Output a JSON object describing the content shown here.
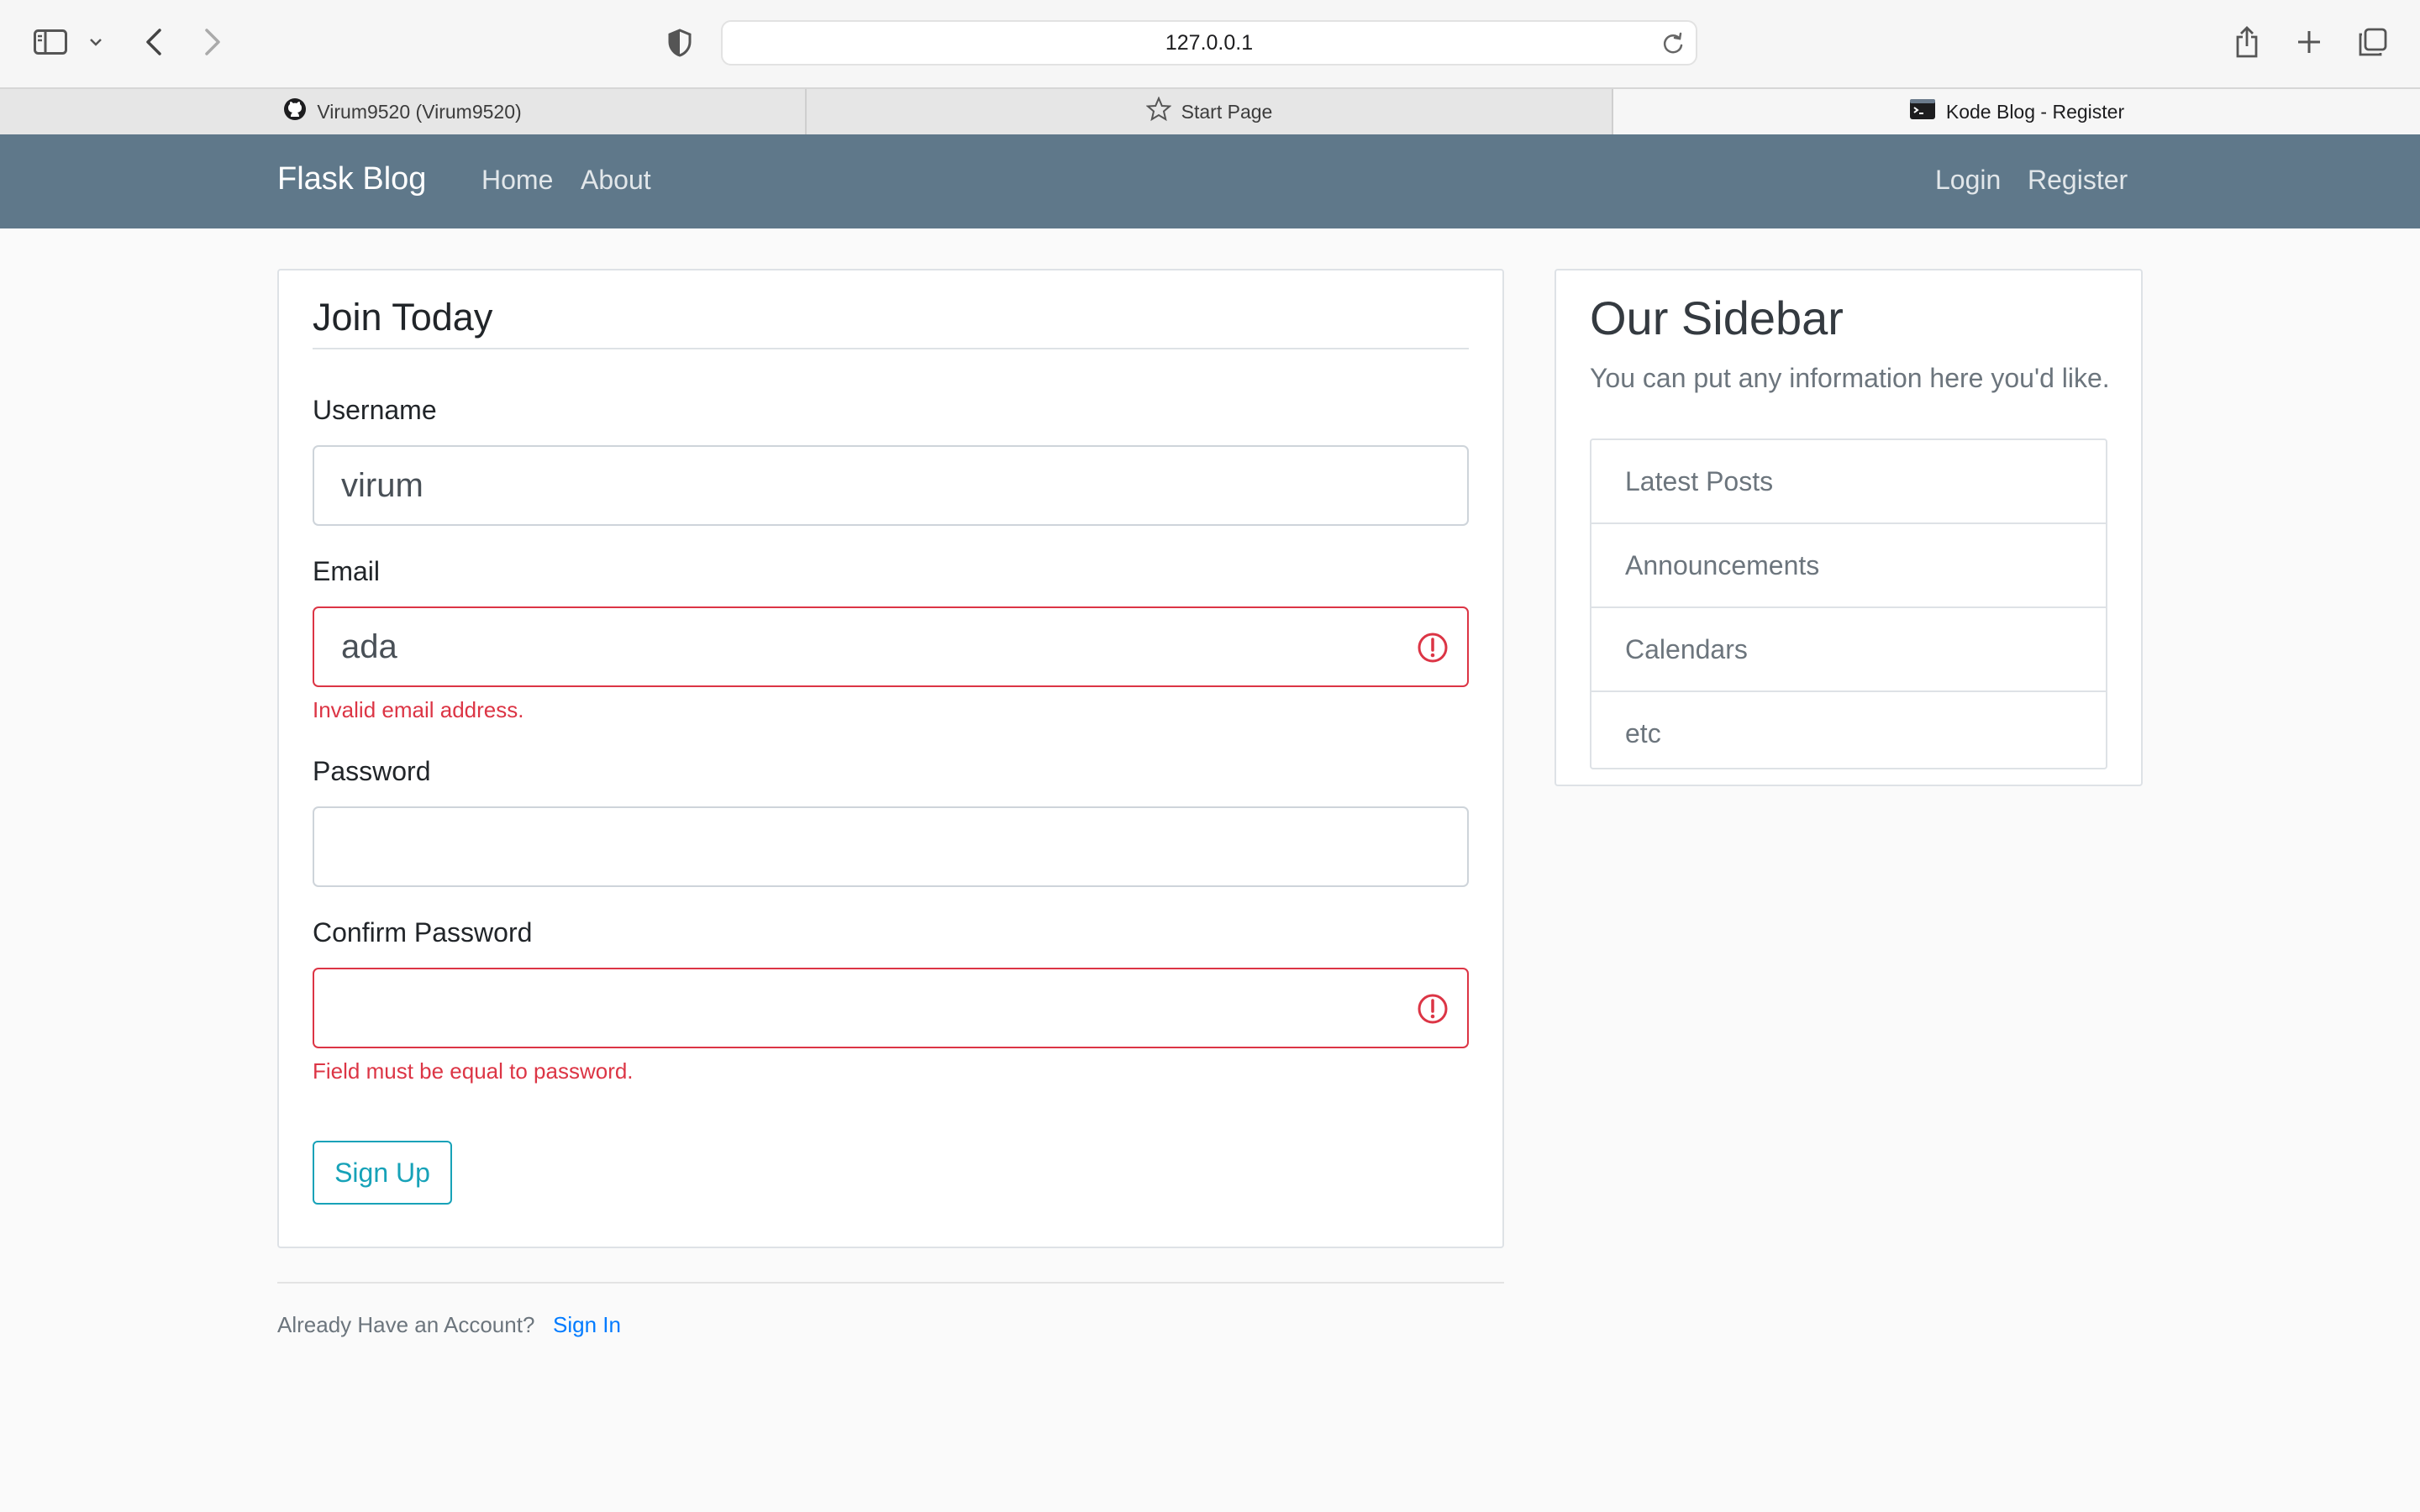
{
  "browser": {
    "url": "127.0.0.1",
    "tabs": [
      {
        "label": "Virum9520 (Virum9520)",
        "icon": "github-icon"
      },
      {
        "label": "Start Page",
        "icon": "star-icon"
      },
      {
        "label": "Kode Blog - Register",
        "icon": "terminal-icon",
        "active": true
      }
    ]
  },
  "navbar": {
    "brand": "Flask Blog",
    "links": [
      "Home",
      "About"
    ],
    "right_links": [
      "Login",
      "Register"
    ],
    "color": "#5f788a"
  },
  "form": {
    "legend": "Join Today",
    "username": {
      "label": "Username",
      "value": "virum"
    },
    "email": {
      "label": "Email",
      "value": "ada",
      "error": "Invalid email address."
    },
    "password": {
      "label": "Password",
      "value": ""
    },
    "confirm": {
      "label": "Confirm Password",
      "value": "",
      "error": "Field must be equal to password."
    },
    "submit": "Sign Up",
    "error_color": "#dc3545",
    "accent_color": "#17a2b8"
  },
  "footer": {
    "text": "Already Have an Account?",
    "link": "Sign In"
  },
  "sidebar": {
    "title": "Our Sidebar",
    "text": "You can put any information here you'd like.",
    "items": [
      "Latest Posts",
      "Announcements",
      "Calendars",
      "etc"
    ]
  }
}
